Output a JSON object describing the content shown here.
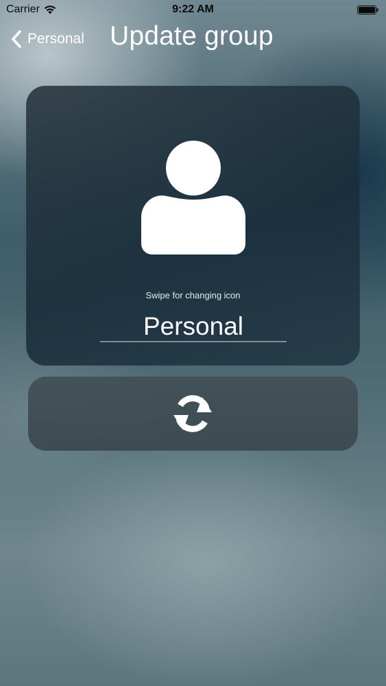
{
  "status_bar": {
    "carrier": "Carrier",
    "time": "9:22 AM"
  },
  "nav": {
    "back_label": "Personal",
    "title": "Update group"
  },
  "group_card": {
    "icon": "person-icon",
    "hint": "Swipe for changing icon",
    "name_value": "Personal"
  },
  "action": {
    "icon": "refresh-icon"
  },
  "colors": {
    "text": "#ffffff",
    "status_text": "#0a0a0a",
    "card_bg": "#1f3542",
    "input_underline": "#7d8e96"
  }
}
